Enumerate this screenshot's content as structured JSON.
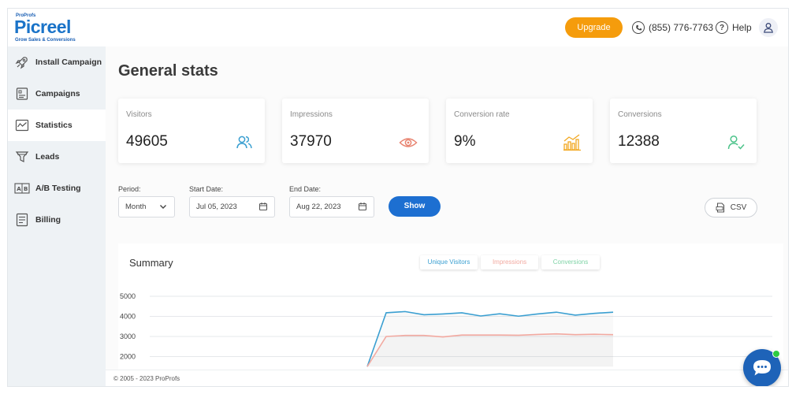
{
  "logo": {
    "parent": "ProProfs",
    "name": "Picreel",
    "tagline": "Grow Sales & Conversions"
  },
  "header": {
    "upgrade_label": "Upgrade",
    "phone": "(855) 776-7763",
    "help_label": "Help"
  },
  "sidebar": {
    "items": [
      {
        "label": "Install Campaign",
        "icon": "rocket-icon"
      },
      {
        "label": "Campaigns",
        "icon": "campaign-list-icon"
      },
      {
        "label": "Statistics",
        "icon": "statistics-chart-icon"
      },
      {
        "label": "Leads",
        "icon": "funnel-icon"
      },
      {
        "label": "A/B Testing",
        "icon": "ab-test-icon"
      },
      {
        "label": "Billing",
        "icon": "billing-document-icon"
      }
    ],
    "active_index": 2
  },
  "main": {
    "title": "General stats",
    "cards": [
      {
        "label": "Visitors",
        "value": "49605",
        "icon": "users-icon",
        "color": "#3a9fd1"
      },
      {
        "label": "Impressions",
        "value": "37970",
        "icon": "eye-icon",
        "color": "#e8836f"
      },
      {
        "label": "Conversion rate",
        "value": "9%",
        "icon": "bar-growth-icon",
        "color": "#f2a820"
      },
      {
        "label": "Conversions",
        "value": "12388",
        "icon": "user-check-icon",
        "color": "#4cc38a"
      }
    ],
    "filters": {
      "period_label": "Period:",
      "period_value": "Month",
      "start_label": "Start Date:",
      "start_value": "Jul 05, 2023",
      "end_label": "End Date:",
      "end_value": "Aug 22, 2023",
      "show_label": "Show",
      "csv_label": "CSV"
    },
    "summary": {
      "title": "Summary",
      "legend": [
        {
          "label": "Unique Visitors",
          "color": "#3a9fd1"
        },
        {
          "label": "Impressions",
          "color": "#f2a9a0"
        },
        {
          "label": "Conversions",
          "color": "#7fd3a6"
        }
      ]
    }
  },
  "chart_data": {
    "type": "line",
    "title": "",
    "xlabel": "",
    "ylabel": "",
    "ylim": [
      1500,
      5000
    ],
    "y_ticks": [
      "5000",
      "4000",
      "3000",
      "2000"
    ],
    "grid": true,
    "series": [
      {
        "name": "Unique Visitors",
        "color": "#3a9fd1",
        "values": [
          null,
          null,
          null,
          null,
          null,
          null,
          null,
          null,
          null,
          null,
          null,
          null,
          1500,
          4180,
          4240,
          4080,
          4120,
          4180,
          4020,
          4130,
          4010,
          4120,
          4210,
          4060,
          4150,
          4210
        ]
      },
      {
        "name": "Impressions",
        "color": "#f2a9a0",
        "values": [
          null,
          null,
          null,
          null,
          null,
          null,
          null,
          null,
          null,
          null,
          null,
          null,
          1500,
          3000,
          3050,
          3050,
          2980,
          3070,
          3070,
          3070,
          3060,
          3100,
          3130,
          3090,
          3110,
          3090
        ]
      }
    ]
  },
  "footer": {
    "copyright": "© 2005 - 2023 ProProfs"
  }
}
